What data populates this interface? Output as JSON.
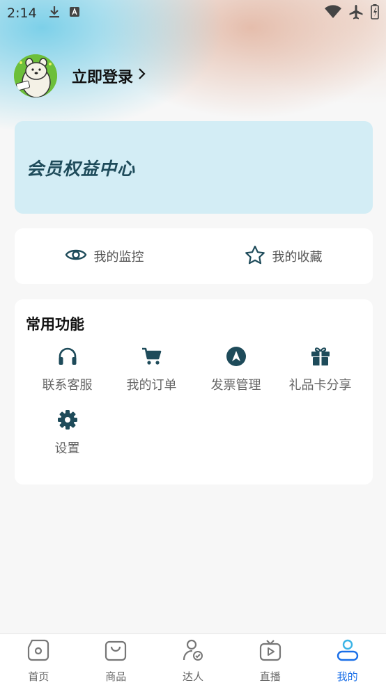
{
  "status_bar": {
    "time": "2:14",
    "left_icons": [
      "download-icon",
      "a-badge-icon"
    ],
    "right_icons": [
      "wifi-icon",
      "airplane-icon",
      "battery-icon"
    ]
  },
  "profile": {
    "login_label": "立即登录",
    "avatar_icon": "cartoon-avatar"
  },
  "vip_card": {
    "title": "会员权益中心"
  },
  "quick_links": [
    {
      "label": "我的监控",
      "icon": "eye-icon"
    },
    {
      "label": "我的收藏",
      "icon": "star-icon"
    }
  ],
  "functions": {
    "title": "常用功能",
    "items": [
      {
        "label": "联系客服",
        "icon": "headphones-icon"
      },
      {
        "label": "我的订单",
        "icon": "cart-icon"
      },
      {
        "label": "发票管理",
        "icon": "navigation-icon"
      },
      {
        "label": "礼品卡分享",
        "icon": "gift-icon"
      },
      {
        "label": "设置",
        "icon": "gear-icon"
      }
    ]
  },
  "tabbar": {
    "active": "我的",
    "items": [
      {
        "label": "首页",
        "icon": "home-icon"
      },
      {
        "label": "商品",
        "icon": "bag-icon"
      },
      {
        "label": "达人",
        "icon": "expert-icon"
      },
      {
        "label": "直播",
        "icon": "live-icon"
      },
      {
        "label": "我的",
        "icon": "user-icon"
      }
    ]
  },
  "colors": {
    "accent": "#1a6fe8",
    "icon_dark": "#1e4b5a",
    "vip_bg": "#d3edf5"
  }
}
